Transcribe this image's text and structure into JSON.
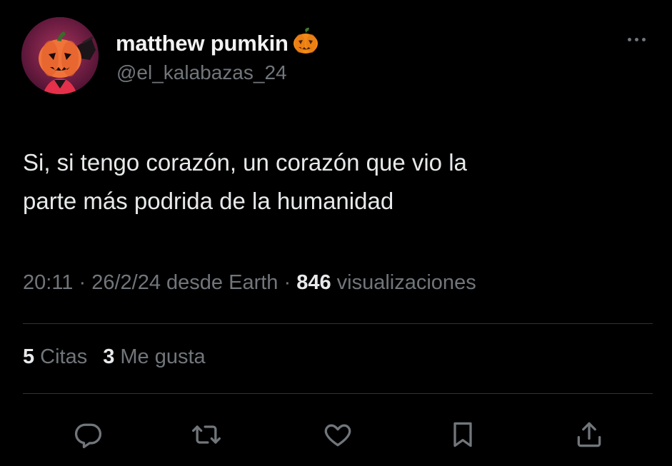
{
  "author": {
    "display_name": "matthew pumkin",
    "emoji_icon": "jack-o-lantern-emoji",
    "handle": "@el_kalabazas_24",
    "avatar_icon": "pumpkin-character-avatar"
  },
  "more_icon": "more-dots-icon",
  "tweet": {
    "text_line_1": "Si, si tengo corazón, un corazón que vio la",
    "text_line_2": "parte más podrida de la humanidad"
  },
  "meta": {
    "time": "20:11",
    "separator_1": " · ",
    "date": "26/2/24",
    "source": " desde Earth",
    "separator_2": " · ",
    "views_count": "846",
    "views_label": " visualizaciones"
  },
  "stats": {
    "quotes_count": "5",
    "quotes_label": "Citas",
    "likes_count": "3",
    "likes_label": "Me gusta"
  },
  "actions": [
    {
      "icon": "reply-icon"
    },
    {
      "icon": "retweet-icon"
    },
    {
      "icon": "like-icon"
    },
    {
      "icon": "bookmark-icon"
    },
    {
      "icon": "share-icon"
    }
  ],
  "colors": {
    "background": "#000000",
    "primary_text": "#e7e9ea",
    "secondary_text": "#71767b",
    "divider": "#2f3336",
    "pumpkin": "#f28a1a"
  }
}
